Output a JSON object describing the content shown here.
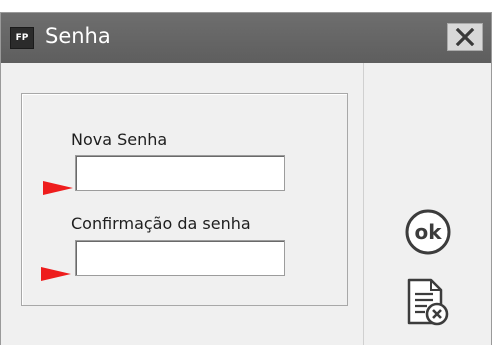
{
  "window": {
    "icon_text": "FP",
    "title": "Senha"
  },
  "form": {
    "new_password_label": "Nova Senha",
    "confirm_password_label": "Confirmação da senha",
    "new_password_value": "",
    "confirm_password_value": ""
  },
  "actions": {
    "ok_label": "ok",
    "ok_icon": "ok-circle-icon",
    "cancel_icon": "document-cancel-icon"
  },
  "colors": {
    "titlebar": "#646464",
    "marker_arrow": "#ee1c1c",
    "icon_stroke": "#3c3c3c"
  }
}
